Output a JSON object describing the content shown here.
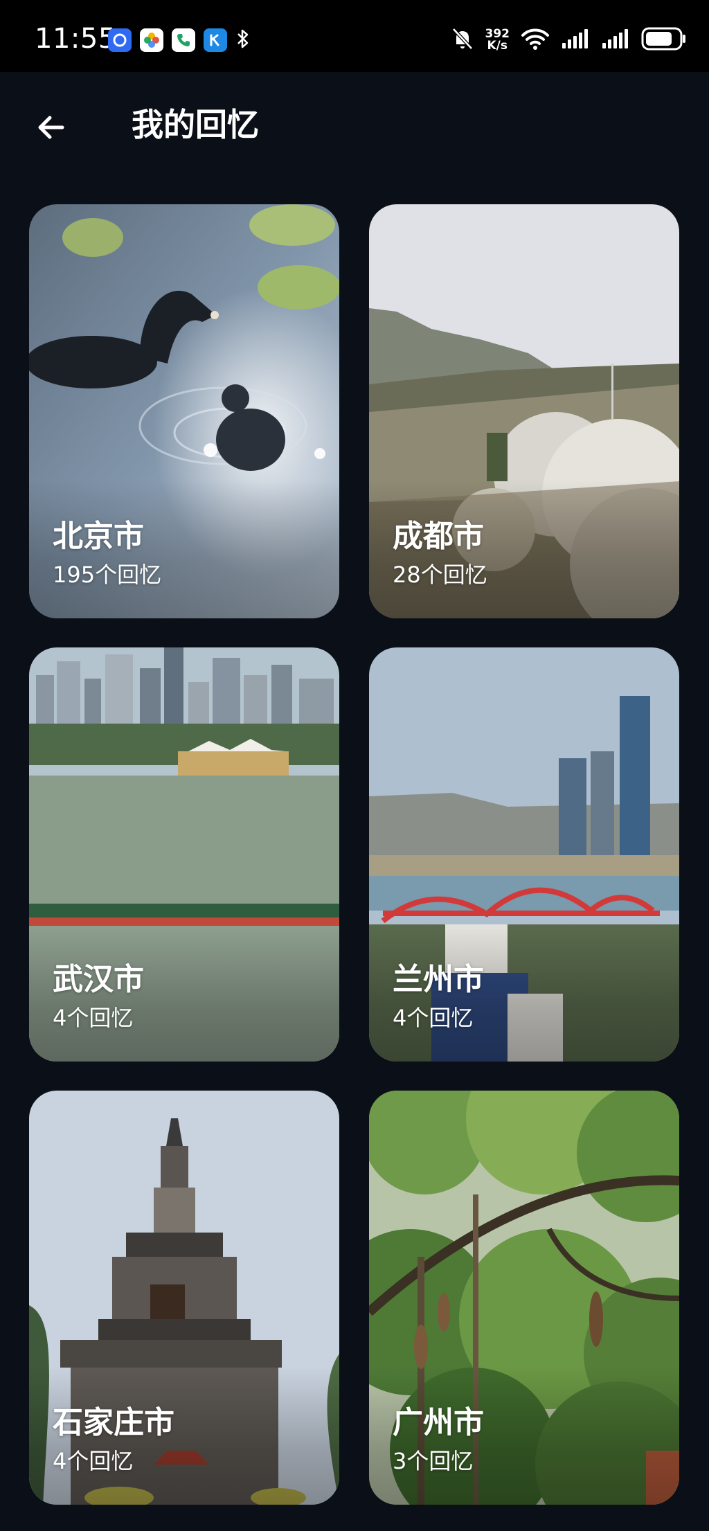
{
  "status_bar": {
    "time": "11:55",
    "net_speed_value": "392",
    "net_speed_unit": "K/s",
    "battery_level": 0.8
  },
  "header": {
    "title": "我的回忆"
  },
  "colors": {
    "background": "#0b0f17",
    "status_bar": "#000000",
    "text": "#ffffff"
  },
  "albums": [
    {
      "city": "北京市",
      "count": "195个回忆",
      "photo": "ducks-on-pond"
    },
    {
      "city": "成都市",
      "count": "28个回忆",
      "photo": "blossom-hillside"
    },
    {
      "city": "武汉市",
      "count": "4个回忆",
      "photo": "river-skyline"
    },
    {
      "city": "兰州市",
      "count": "4个回忆",
      "photo": "red-bridge-city"
    },
    {
      "city": "石家庄市",
      "count": "4个回忆",
      "photo": "ancient-pagoda"
    },
    {
      "city": "广州市",
      "count": "3个回忆",
      "photo": "sausage-tree"
    }
  ]
}
